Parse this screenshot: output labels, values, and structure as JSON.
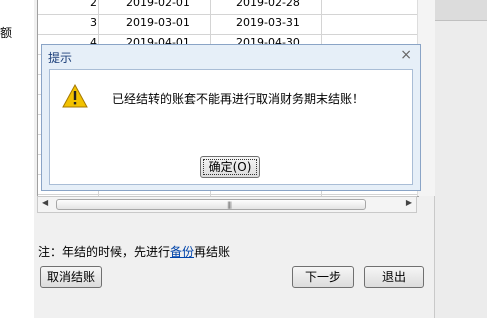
{
  "background": {
    "left_char": "额"
  },
  "grid": {
    "rows": [
      {
        "no": "2",
        "start": "2019-02-01",
        "end": "2019-02-28"
      },
      {
        "no": "3",
        "start": "2019-03-01",
        "end": "2019-03-31"
      },
      {
        "no": "4",
        "start": "2019-04-01",
        "end": "2019-04-30"
      }
    ]
  },
  "dialog": {
    "title": "提示",
    "close_glyph": "×",
    "message": "已经结转的账套不能再进行取消财务期末结账！",
    "ok_label": "确定(O)"
  },
  "note": {
    "prefix": "注：年结的时候，先进行",
    "link": "备份",
    "suffix": "再结账"
  },
  "buttons": {
    "cancel_close": "取消结账",
    "next": "下一步",
    "exit": "退出"
  },
  "colors": {
    "warning": "#f2c200",
    "dialog_title": "#1c3f7a",
    "link": "#0044aa"
  }
}
